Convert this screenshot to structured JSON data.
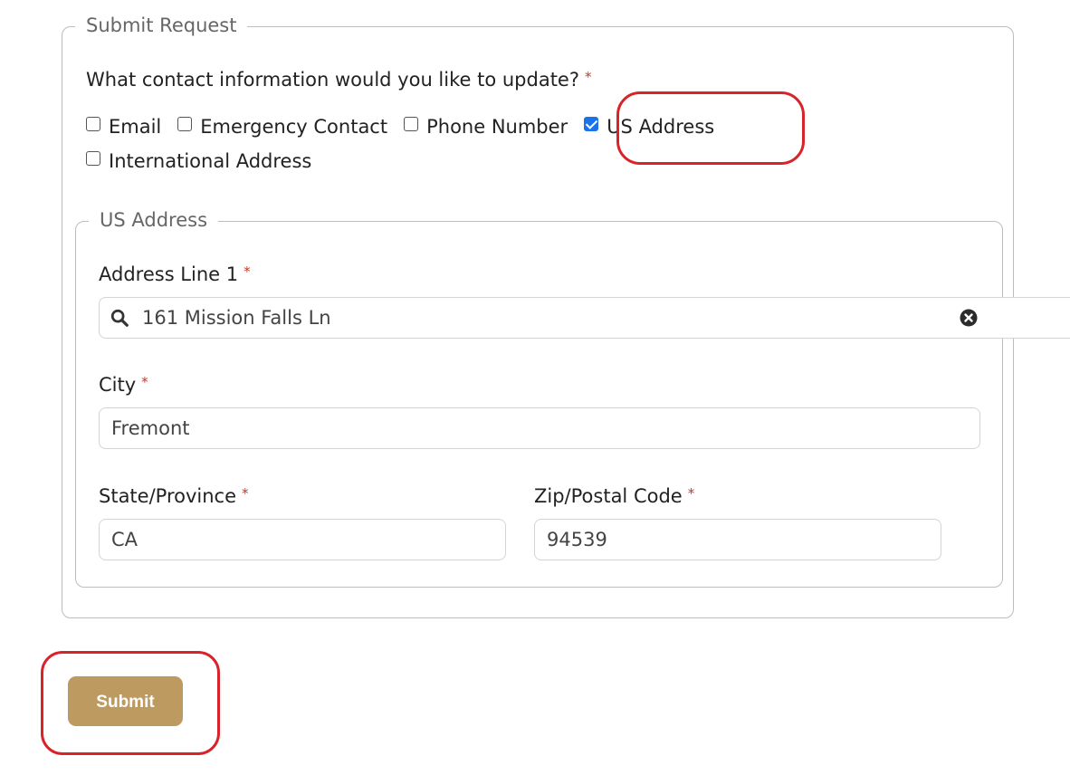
{
  "form": {
    "legend": "Submit Request",
    "question": "What contact information would you like to update?",
    "required_mark": "*",
    "options": [
      {
        "label": "Email",
        "checked": false
      },
      {
        "label": "Emergency Contact",
        "checked": false
      },
      {
        "label": "Phone Number",
        "checked": false
      },
      {
        "label": "US Address",
        "checked": true
      },
      {
        "label": "International Address",
        "checked": false
      }
    ]
  },
  "us_address": {
    "legend": "US Address",
    "address_line1_label": "Address Line 1",
    "address_line1_value": "161 Mission Falls Ln",
    "city_label": "City",
    "city_value": "Fremont",
    "state_label": "State/Province",
    "state_value": "CA",
    "zip_label": "Zip/Postal Code",
    "zip_value": "94539"
  },
  "submit_label": "Submit",
  "colors": {
    "button": "#bd9a5f",
    "checkbox_checked": "#1a73e8",
    "required": "#c0392b",
    "annotation": "#d8232a"
  }
}
